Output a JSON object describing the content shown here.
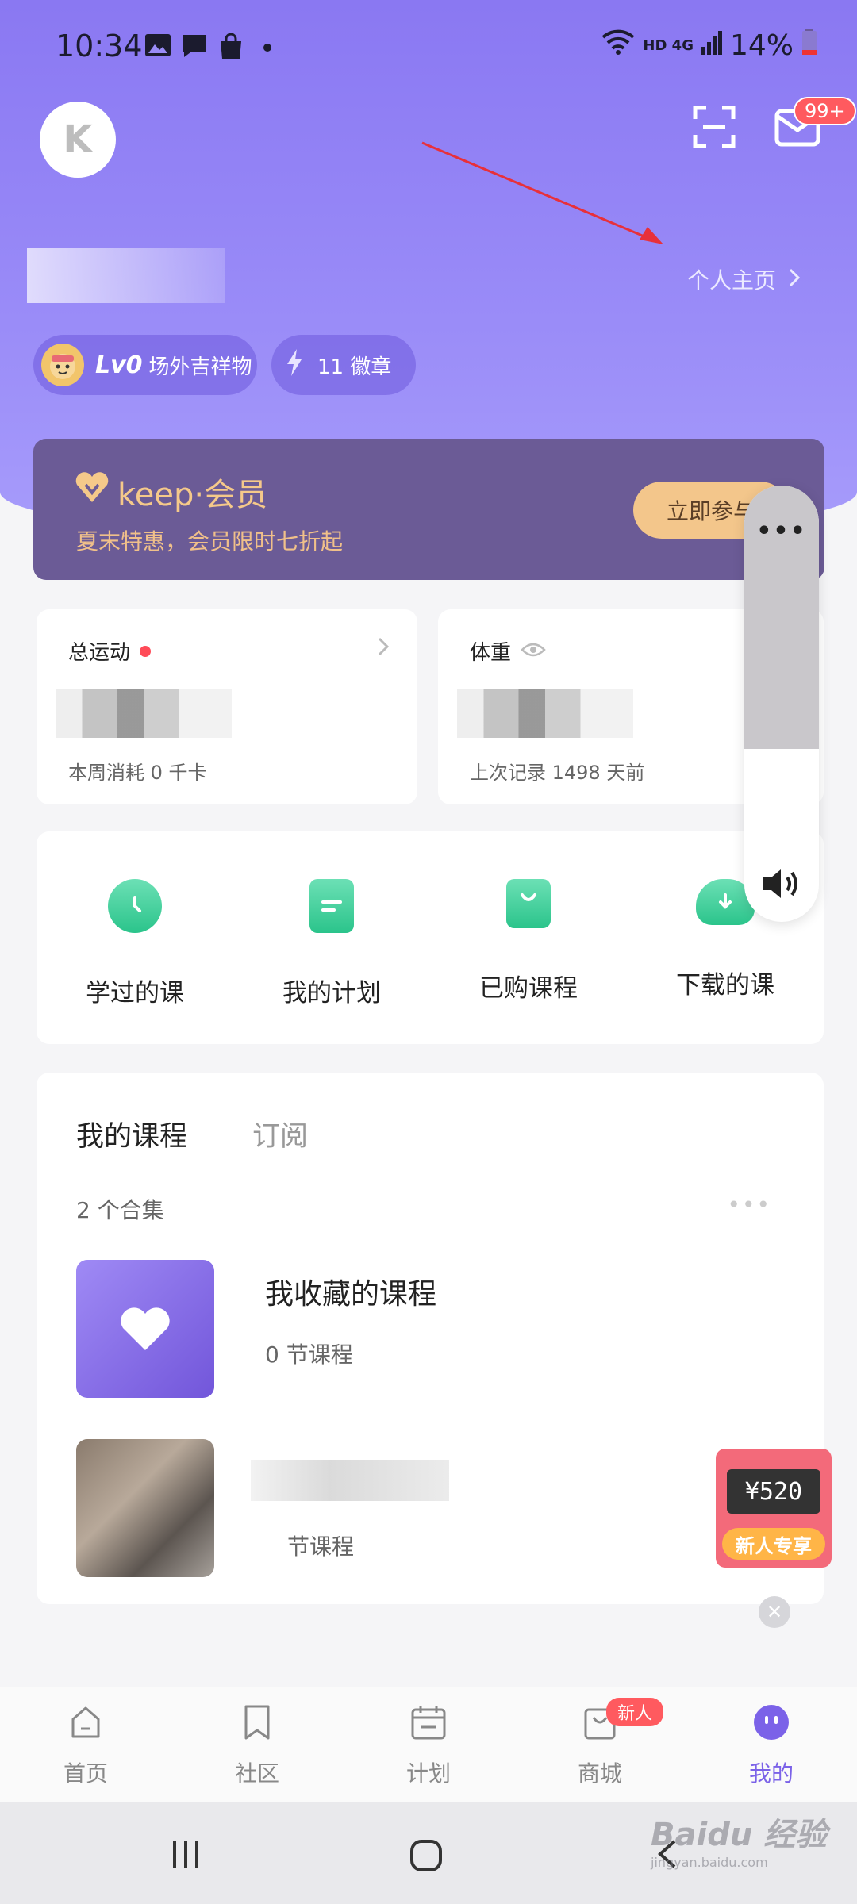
{
  "status": {
    "time": "10:34",
    "network": "HD 4G",
    "battery": "14%"
  },
  "header": {
    "avatar_letter": "K",
    "notif_count": "99+",
    "homepage_link": "个人主页"
  },
  "chips": {
    "level": "Lv0",
    "level_title": "场外吉祥物",
    "badges": "11 徽章"
  },
  "vip": {
    "brand": "keep·会员",
    "promo": "夏末特惠，会员限时七折起",
    "join_label": "立即参与"
  },
  "stats": {
    "total": {
      "title": "总运动",
      "sub": "本周消耗 0 千卡"
    },
    "weight": {
      "title": "体重",
      "sub": "上次记录 1498 天前"
    }
  },
  "quick": [
    {
      "label": "学过的课"
    },
    {
      "label": "我的计划"
    },
    {
      "label": "已购课程"
    },
    {
      "label": "下载的课"
    }
  ],
  "side": {
    "more": "•••"
  },
  "courses": {
    "tab_active": "我的课程",
    "tab_inactive": "订阅",
    "count": "2 个合集",
    "items": [
      {
        "title": "我收藏的课程",
        "sub": "0 节课程"
      },
      {
        "title": "",
        "sub": "节课程"
      }
    ]
  },
  "gift": {
    "price": "¥520",
    "tag": "新人专享"
  },
  "tabbar": {
    "items": [
      {
        "label": "首页"
      },
      {
        "label": "社区"
      },
      {
        "label": "计划"
      },
      {
        "label": "商城"
      },
      {
        "label": "我的"
      }
    ],
    "new_badge": "新人"
  },
  "watermark": {
    "brand": "Baidu 经验",
    "url": "jingyan.baidu.com"
  },
  "colors": {
    "accent": "#7b62e8",
    "hero": "#8a78f2",
    "vip_bg": "#6b5b96",
    "gold": "#f3c68b",
    "green": "#2bc48b",
    "red": "#ff5a5f"
  }
}
